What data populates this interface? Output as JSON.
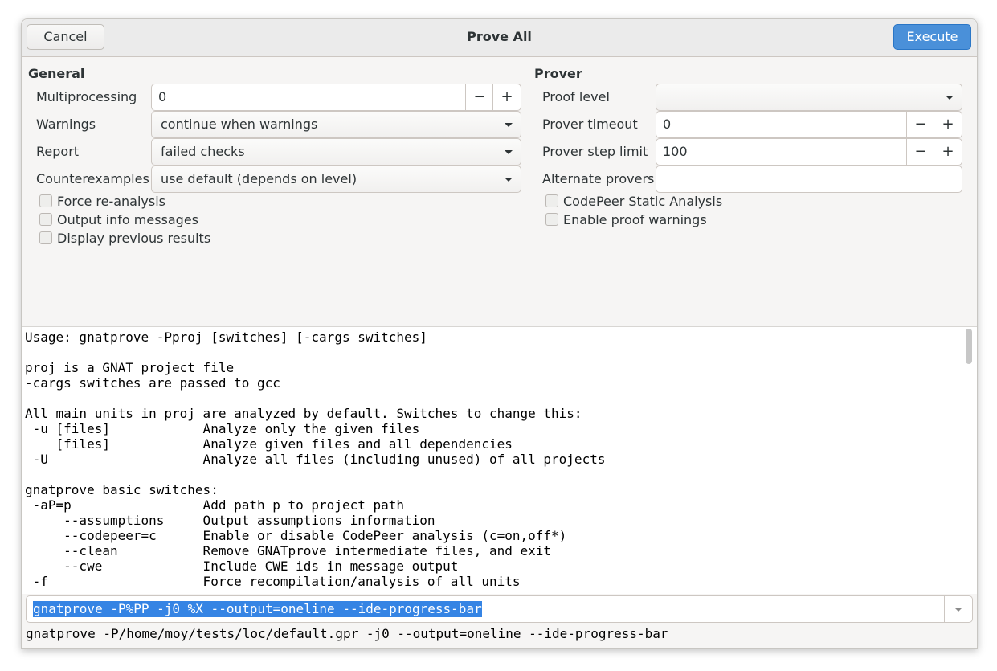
{
  "window": {
    "title": "Prove All",
    "cancel_label": "Cancel",
    "execute_label": "Execute"
  },
  "general": {
    "title": "General",
    "multiprocessing": {
      "label": "Multiprocessing",
      "value": "0",
      "minus": "−",
      "plus": "+"
    },
    "warnings": {
      "label": "Warnings",
      "value": "continue when warnings"
    },
    "report": {
      "label": "Report",
      "value": "failed checks"
    },
    "counterexamples": {
      "label": "Counterexamples",
      "value": "use default (depends on level)"
    },
    "checks": [
      "Force re-analysis",
      "Output info messages",
      "Display previous results"
    ]
  },
  "prover": {
    "title": "Prover",
    "proof_level": {
      "label": "Proof level",
      "value": ""
    },
    "prover_timeout": {
      "label": "Prover timeout",
      "value": "0",
      "minus": "−",
      "plus": "+"
    },
    "prover_step_limit": {
      "label": "Prover step limit",
      "value": "100",
      "minus": "−",
      "plus": "+"
    },
    "alternate_provers": {
      "label": "Alternate provers",
      "value": ""
    },
    "checks": [
      "CodePeer Static Analysis",
      "Enable proof warnings"
    ]
  },
  "help_text": "Usage: gnatprove -Pproj [switches] [-cargs switches]\n\nproj is a GNAT project file\n-cargs switches are passed to gcc\n\nAll main units in proj are analyzed by default. Switches to change this:\n -u [files]            Analyze only the given files\n    [files]            Analyze given files and all dependencies\n -U                    Analyze all files (including unused) of all projects\n\ngnatprove basic switches:\n -aP=p                 Add path p to project path\n     --assumptions     Output assumptions information\n     --codepeer=c      Enable or disable CodePeer analysis (c=on,off*)\n     --clean           Remove GNATprove intermediate files, and exit\n     --cwe             Include CWE ids in message output\n -f                    Force recompilation/analysis of all units",
  "command": {
    "value": "gnatprove -P%PP -j0 %X --output=oneline --ide-progress-bar",
    "expanded": "gnatprove -P/home/moy/tests/loc/default.gpr -j0 --output=oneline --ide-progress-bar"
  }
}
